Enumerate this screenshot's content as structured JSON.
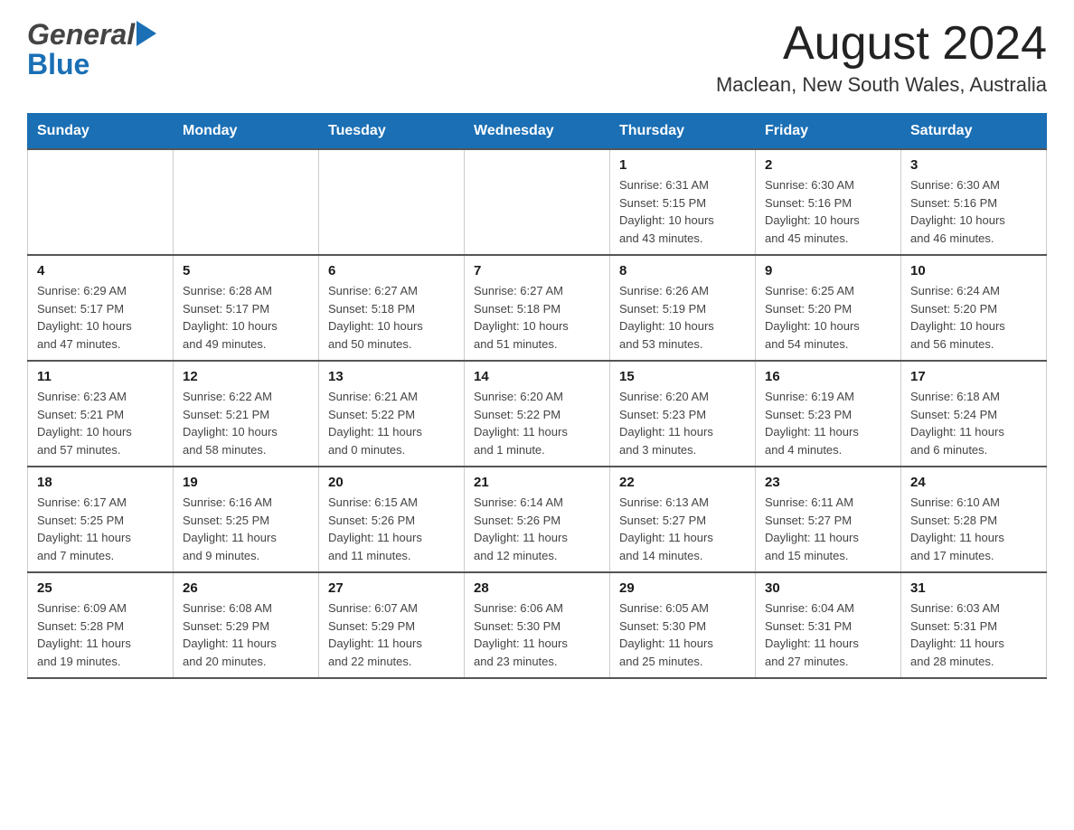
{
  "header": {
    "logo_general": "General",
    "logo_blue": "Blue",
    "title": "August 2024",
    "subtitle": "Maclean, New South Wales, Australia"
  },
  "days_of_week": [
    "Sunday",
    "Monday",
    "Tuesday",
    "Wednesday",
    "Thursday",
    "Friday",
    "Saturday"
  ],
  "weeks": [
    {
      "days": [
        {
          "number": "",
          "info": ""
        },
        {
          "number": "",
          "info": ""
        },
        {
          "number": "",
          "info": ""
        },
        {
          "number": "",
          "info": ""
        },
        {
          "number": "1",
          "info": "Sunrise: 6:31 AM\nSunset: 5:15 PM\nDaylight: 10 hours\nand 43 minutes."
        },
        {
          "number": "2",
          "info": "Sunrise: 6:30 AM\nSunset: 5:16 PM\nDaylight: 10 hours\nand 45 minutes."
        },
        {
          "number": "3",
          "info": "Sunrise: 6:30 AM\nSunset: 5:16 PM\nDaylight: 10 hours\nand 46 minutes."
        }
      ]
    },
    {
      "days": [
        {
          "number": "4",
          "info": "Sunrise: 6:29 AM\nSunset: 5:17 PM\nDaylight: 10 hours\nand 47 minutes."
        },
        {
          "number": "5",
          "info": "Sunrise: 6:28 AM\nSunset: 5:17 PM\nDaylight: 10 hours\nand 49 minutes."
        },
        {
          "number": "6",
          "info": "Sunrise: 6:27 AM\nSunset: 5:18 PM\nDaylight: 10 hours\nand 50 minutes."
        },
        {
          "number": "7",
          "info": "Sunrise: 6:27 AM\nSunset: 5:18 PM\nDaylight: 10 hours\nand 51 minutes."
        },
        {
          "number": "8",
          "info": "Sunrise: 6:26 AM\nSunset: 5:19 PM\nDaylight: 10 hours\nand 53 minutes."
        },
        {
          "number": "9",
          "info": "Sunrise: 6:25 AM\nSunset: 5:20 PM\nDaylight: 10 hours\nand 54 minutes."
        },
        {
          "number": "10",
          "info": "Sunrise: 6:24 AM\nSunset: 5:20 PM\nDaylight: 10 hours\nand 56 minutes."
        }
      ]
    },
    {
      "days": [
        {
          "number": "11",
          "info": "Sunrise: 6:23 AM\nSunset: 5:21 PM\nDaylight: 10 hours\nand 57 minutes."
        },
        {
          "number": "12",
          "info": "Sunrise: 6:22 AM\nSunset: 5:21 PM\nDaylight: 10 hours\nand 58 minutes."
        },
        {
          "number": "13",
          "info": "Sunrise: 6:21 AM\nSunset: 5:22 PM\nDaylight: 11 hours\nand 0 minutes."
        },
        {
          "number": "14",
          "info": "Sunrise: 6:20 AM\nSunset: 5:22 PM\nDaylight: 11 hours\nand 1 minute."
        },
        {
          "number": "15",
          "info": "Sunrise: 6:20 AM\nSunset: 5:23 PM\nDaylight: 11 hours\nand 3 minutes."
        },
        {
          "number": "16",
          "info": "Sunrise: 6:19 AM\nSunset: 5:23 PM\nDaylight: 11 hours\nand 4 minutes."
        },
        {
          "number": "17",
          "info": "Sunrise: 6:18 AM\nSunset: 5:24 PM\nDaylight: 11 hours\nand 6 minutes."
        }
      ]
    },
    {
      "days": [
        {
          "number": "18",
          "info": "Sunrise: 6:17 AM\nSunset: 5:25 PM\nDaylight: 11 hours\nand 7 minutes."
        },
        {
          "number": "19",
          "info": "Sunrise: 6:16 AM\nSunset: 5:25 PM\nDaylight: 11 hours\nand 9 minutes."
        },
        {
          "number": "20",
          "info": "Sunrise: 6:15 AM\nSunset: 5:26 PM\nDaylight: 11 hours\nand 11 minutes."
        },
        {
          "number": "21",
          "info": "Sunrise: 6:14 AM\nSunset: 5:26 PM\nDaylight: 11 hours\nand 12 minutes."
        },
        {
          "number": "22",
          "info": "Sunrise: 6:13 AM\nSunset: 5:27 PM\nDaylight: 11 hours\nand 14 minutes."
        },
        {
          "number": "23",
          "info": "Sunrise: 6:11 AM\nSunset: 5:27 PM\nDaylight: 11 hours\nand 15 minutes."
        },
        {
          "number": "24",
          "info": "Sunrise: 6:10 AM\nSunset: 5:28 PM\nDaylight: 11 hours\nand 17 minutes."
        }
      ]
    },
    {
      "days": [
        {
          "number": "25",
          "info": "Sunrise: 6:09 AM\nSunset: 5:28 PM\nDaylight: 11 hours\nand 19 minutes."
        },
        {
          "number": "26",
          "info": "Sunrise: 6:08 AM\nSunset: 5:29 PM\nDaylight: 11 hours\nand 20 minutes."
        },
        {
          "number": "27",
          "info": "Sunrise: 6:07 AM\nSunset: 5:29 PM\nDaylight: 11 hours\nand 22 minutes."
        },
        {
          "number": "28",
          "info": "Sunrise: 6:06 AM\nSunset: 5:30 PM\nDaylight: 11 hours\nand 23 minutes."
        },
        {
          "number": "29",
          "info": "Sunrise: 6:05 AM\nSunset: 5:30 PM\nDaylight: 11 hours\nand 25 minutes."
        },
        {
          "number": "30",
          "info": "Sunrise: 6:04 AM\nSunset: 5:31 PM\nDaylight: 11 hours\nand 27 minutes."
        },
        {
          "number": "31",
          "info": "Sunrise: 6:03 AM\nSunset: 5:31 PM\nDaylight: 11 hours\nand 28 minutes."
        }
      ]
    }
  ]
}
